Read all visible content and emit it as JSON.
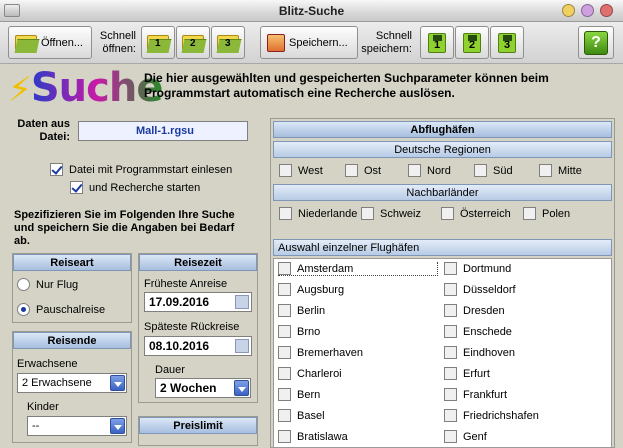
{
  "window": {
    "title": "Blitz-Suche"
  },
  "toolbar": {
    "open_label": "Öffnen...",
    "quick_open_label_1": "Schnell",
    "quick_open_label_2": "öffnen:",
    "slots": [
      "1",
      "2",
      "3"
    ],
    "save_label": "Speichern...",
    "quick_save_label_1": "Schnell",
    "quick_save_label_2": "speichern:"
  },
  "header": {
    "logo_text": "Suche",
    "description_1": "Die hier ausgewählten und gespeicherten Suchparameter können beim",
    "description_2": "Programmstart automatisch eine Recherche auslösen."
  },
  "data_file": {
    "label_1": "Daten aus",
    "label_2": "Datei:",
    "value": "Mall-1.rgsu",
    "load_on_start_label": "Datei mit Programmstart einlesen",
    "load_on_start_checked": true,
    "start_search_label": "und Recherche starten",
    "start_search_checked": true
  },
  "instructions": {
    "line1": "Spezifizieren Sie im Folgenden Ihre Suche",
    "line2": "und speichern Sie die Angaben bei Bedarf",
    "line3": "ab."
  },
  "reiseart": {
    "title": "Reiseart",
    "options": [
      "Nur Flug",
      "Pauschalreise"
    ],
    "selected": "Pauschalreise"
  },
  "reisezeit": {
    "title": "Reisezeit",
    "earliest_label": "Früheste Anreise",
    "earliest_value": "17.09.2016",
    "latest_label": "Späteste Rückreise",
    "latest_value": "08.10.2016",
    "duration_label": "Dauer",
    "duration_value": "2 Wochen"
  },
  "reisende": {
    "title": "Reisende",
    "adults_label": "Erwachsene",
    "adults_value": "2 Erwachsene",
    "children_label": "Kinder",
    "children_value": "--"
  },
  "preislimit": {
    "title": "Preislimit"
  },
  "airports": {
    "title": "Abflughäfen",
    "regions_title": "Deutsche Regionen",
    "regions": [
      "West",
      "Ost",
      "Nord",
      "Süd",
      "Mitte"
    ],
    "neighbors_title": "Nachbarländer",
    "neighbors": [
      "Niederlande",
      "Schweiz",
      "Österreich",
      "Polen"
    ],
    "selection_title": "Auswahl einzelner Flughäfen",
    "col1": [
      "Amsterdam",
      "Augsburg",
      "Berlin",
      "Brno",
      "Bremerhaven",
      "Charleroi",
      "Bern",
      "Basel",
      "Bratislawa"
    ],
    "col2": [
      "Dortmund",
      "Düsseldorf",
      "Dresden",
      "Enschede",
      "Eindhoven",
      "Erfurt",
      "Frankfurt",
      "Friedrichshafen",
      "Genf"
    ]
  },
  "colors": {
    "section_header": "#a6bedf",
    "check_mark": "#1a3aa0",
    "disk_green": "#8fd12f",
    "folder_yellow": "#f2d64b"
  }
}
